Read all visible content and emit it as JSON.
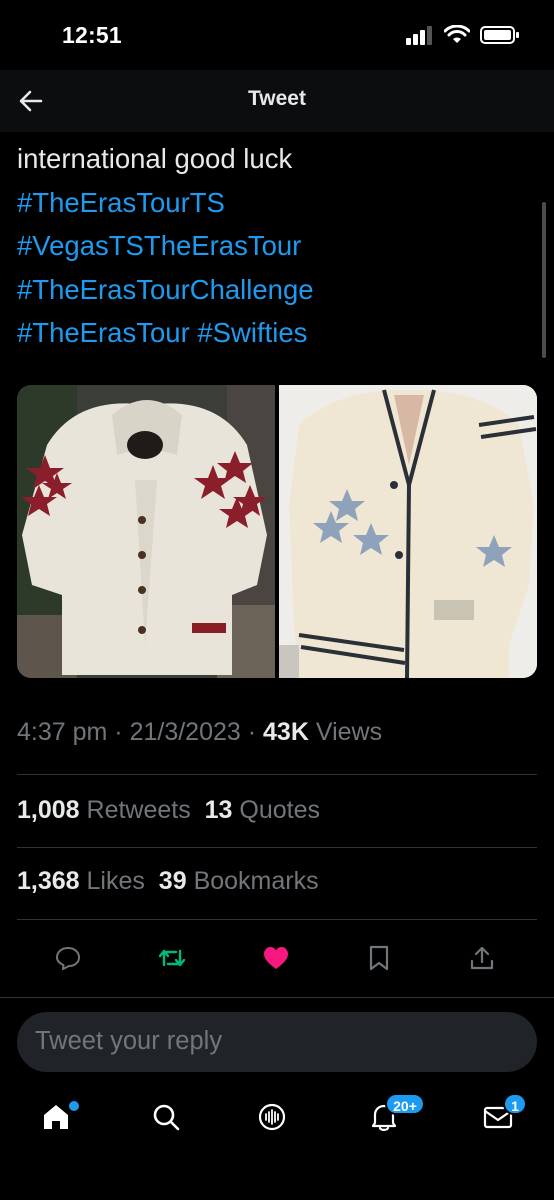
{
  "status_bar": {
    "time": "12:51"
  },
  "header": {
    "title": "Tweet",
    "back_icon": "arrow-left-icon"
  },
  "tweet": {
    "text_lines": [
      {
        "text": "international good luck",
        "is_hashtag": false
      },
      {
        "text": "#TheErasTourTS",
        "is_hashtag": true
      },
      {
        "text": "#VegasTSTheErasTour",
        "is_hashtag": true
      },
      {
        "text": "#TheErasTourChallenge",
        "is_hashtag": true
      }
    ],
    "last_line": {
      "tag1": "#TheErasTour",
      "tag2": "#Swifties"
    },
    "images": [
      {
        "description": "cream-cardigan-red-stars"
      },
      {
        "description": "cream-cardigan-blue-stars"
      }
    ],
    "time": "4:37 pm",
    "date": "21/3/2023",
    "views_count": "43K",
    "views_label": "Views",
    "retweets_count": "1,008",
    "retweets_label": "Retweets",
    "quotes_count": "13",
    "quotes_label": "Quotes",
    "likes_count": "1,368",
    "likes_label": "Likes",
    "bookmarks_count": "39",
    "bookmarks_label": "Bookmarks"
  },
  "actions": {
    "reply_icon": "comment-icon",
    "retweet_icon": "retweet-icon",
    "like_icon": "heart-icon",
    "bookmark_icon": "bookmark-icon",
    "share_icon": "share-icon"
  },
  "reply": {
    "placeholder": "Tweet your reply"
  },
  "bottom_nav": {
    "notifications_badge": "20+",
    "messages_badge": "1"
  },
  "colors": {
    "accent": "#1d9bf0",
    "retweet_active": "#00ba7c",
    "like_active": "#f91880",
    "muted_text": "#71767b"
  }
}
